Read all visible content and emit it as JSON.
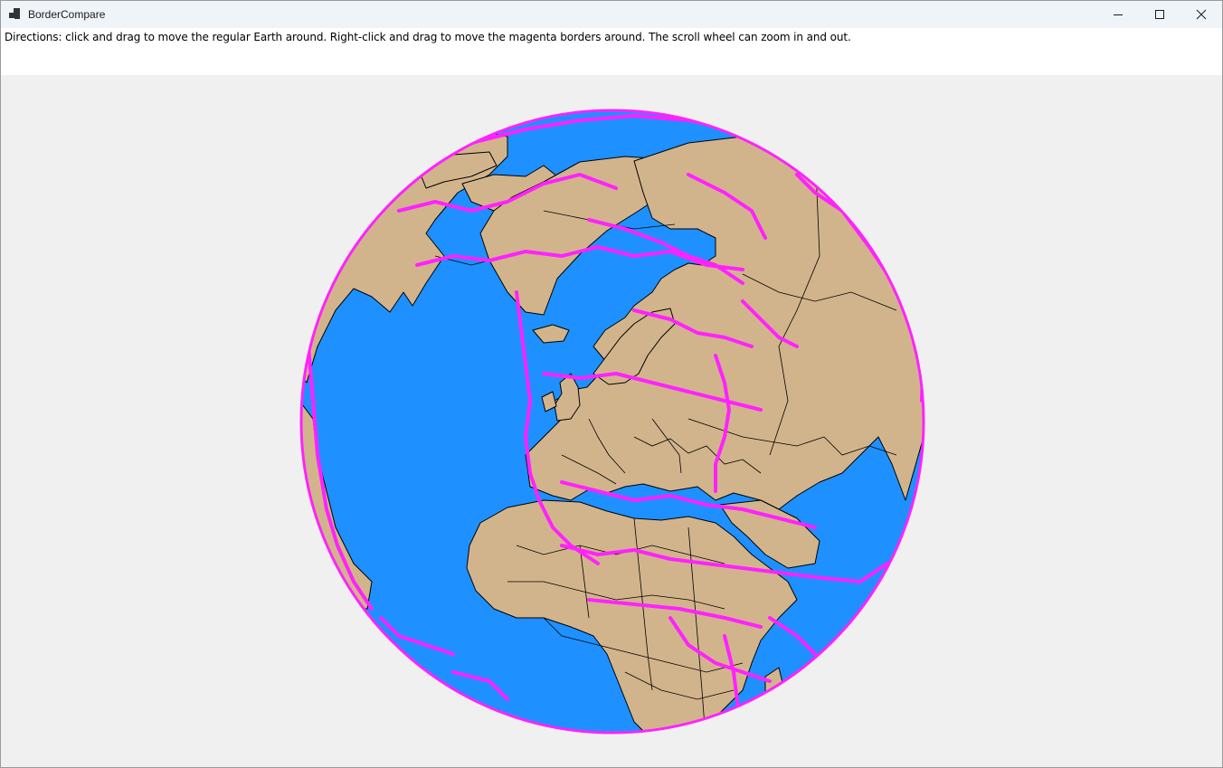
{
  "window": {
    "title": "BorderCompare",
    "icon": "app-window-icon",
    "controls": [
      "minimize-icon",
      "maximize-icon",
      "close-icon"
    ]
  },
  "directions": {
    "text": "Directions: click and drag to move the regular Earth around. Right-click and drag to move the magenta borders around. The scroll wheel can zoom in and out."
  },
  "globe": {
    "ocean_color": "#1e90ff",
    "land_color": "#d2b48c",
    "border_color": "#000000",
    "overlay_border_color": "#ff22ff"
  }
}
